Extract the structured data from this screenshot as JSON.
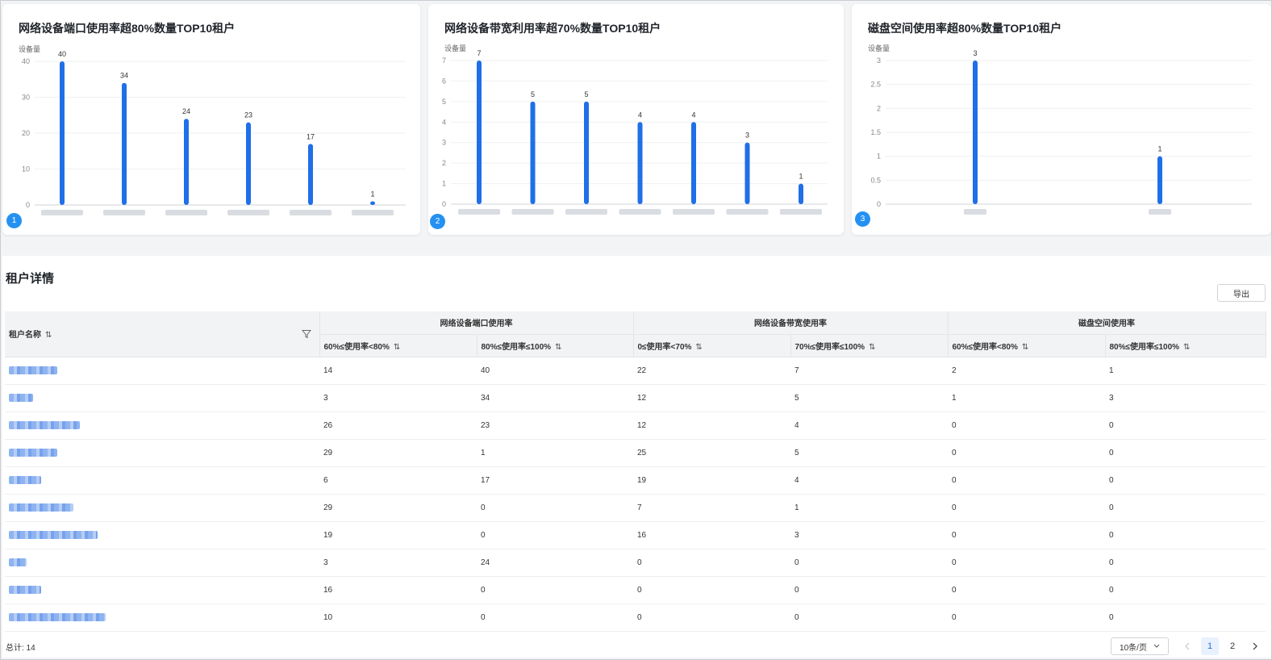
{
  "charts": [
    {
      "title": "网络设备端口使用率超80%数量TOP10租户",
      "badge": "1",
      "chart_data": {
        "type": "bar",
        "ylabel": "设备量",
        "ylim": [
          0,
          40
        ],
        "yticks": [
          0,
          10,
          20,
          30,
          40
        ],
        "values": [
          40,
          34,
          24,
          23,
          17,
          1
        ]
      }
    },
    {
      "title": "网络设备带宽利用率超70%数量TOP10租户",
      "badge": "2",
      "chart_data": {
        "type": "bar",
        "ylabel": "设备量",
        "ylim": [
          0,
          7
        ],
        "yticks": [
          0,
          1,
          2,
          3,
          4,
          5,
          6,
          7
        ],
        "values": [
          7,
          5,
          5,
          4,
          4,
          3,
          1
        ]
      }
    },
    {
      "title": "磁盘空间使用率超80%数量TOP10租户",
      "badge": "3",
      "chart_data": {
        "type": "bar",
        "ylabel": "设备量",
        "ylim": [
          0,
          3
        ],
        "yticks": [
          0,
          0.5,
          1,
          1.5,
          2,
          2.5,
          3
        ],
        "values": [
          3,
          1
        ]
      }
    }
  ],
  "details": {
    "title": "租户详情",
    "export_label": "导出",
    "col_tenant": "租户名称",
    "groups": [
      "网络设备端口使用率",
      "网络设备带宽使用率",
      "磁盘空间使用率"
    ],
    "subcols": [
      "60%≤使用率<80%",
      "80%≤使用率≤100%",
      "0≤使用率<70%",
      "70%≤使用率≤100%",
      "60%≤使用率<80%",
      "80%≤使用率≤100%"
    ],
    "sort_icon": "⇅",
    "rows": [
      [
        14,
        40,
        22,
        7,
        2,
        1
      ],
      [
        3,
        34,
        12,
        5,
        1,
        3
      ],
      [
        26,
        23,
        12,
        4,
        0,
        0
      ],
      [
        29,
        1,
        25,
        5,
        0,
        0
      ],
      [
        6,
        17,
        19,
        4,
        0,
        0
      ],
      [
        29,
        0,
        7,
        1,
        0,
        0
      ],
      [
        19,
        0,
        16,
        3,
        0,
        0
      ],
      [
        3,
        24,
        0,
        0,
        0,
        0
      ],
      [
        16,
        0,
        0,
        0,
        0,
        0
      ],
      [
        10,
        0,
        0,
        0,
        0,
        0
      ]
    ],
    "total_label": "总计: 14",
    "page_size_label": "10条/页",
    "pages": [
      "1",
      "2"
    ],
    "current_page": "1"
  },
  "colors": {
    "bar": "#1f6fe8",
    "badge": "#2491f2",
    "link_blur": "#7aa6ee"
  }
}
